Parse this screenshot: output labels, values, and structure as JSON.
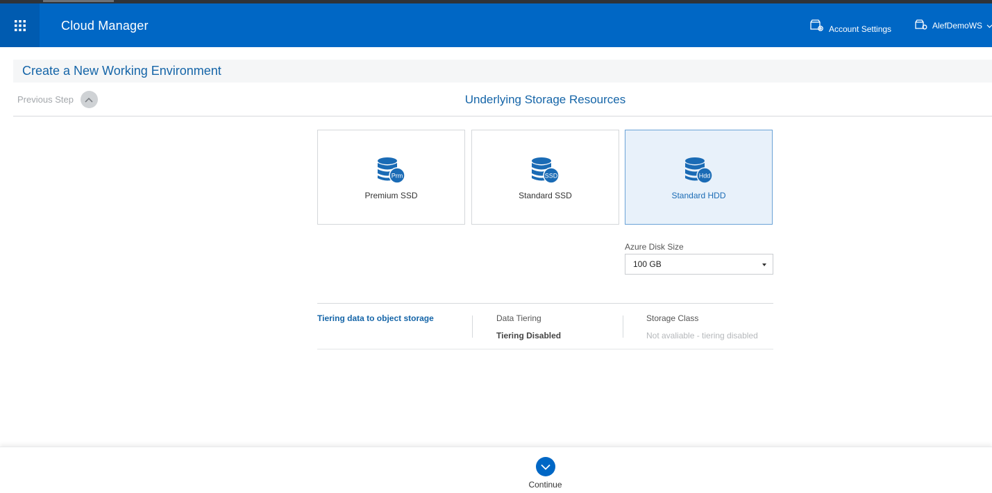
{
  "header": {
    "app_title": "Cloud Manager",
    "menu_icon": "grid-icon",
    "account_settings_label": "Account Settings",
    "workspace_label": "AlefDemoWS",
    "brand_color": "#0067c5"
  },
  "page": {
    "title": "Create a New Working Environment",
    "previous_step_label": "Previous Step",
    "section_title": "Underlying Storage Resources"
  },
  "storage_options": [
    {
      "label": "Premium SSD",
      "badge": "Prm",
      "selected": false
    },
    {
      "label": "Standard SSD",
      "badge": "SSD",
      "selected": false
    },
    {
      "label": "Standard HDD",
      "badge": "Hdd",
      "selected": true
    }
  ],
  "disk_size": {
    "label": "Azure Disk Size",
    "value": "100 GB"
  },
  "tiering": {
    "link_label": "Tiering data to object storage",
    "data_tiering_label": "Data Tiering",
    "data_tiering_value": "Tiering Disabled",
    "storage_class_label": "Storage Class",
    "storage_class_value": "Not avaliable - tiering disabled"
  },
  "footer": {
    "continue_label": "Continue"
  }
}
